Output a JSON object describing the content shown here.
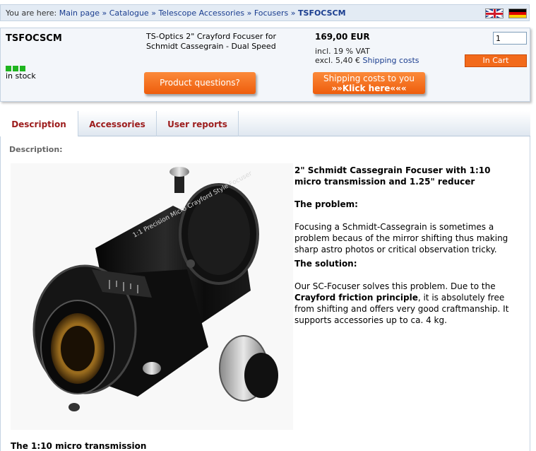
{
  "breadcrumb": {
    "prefix": "You are here:",
    "items": [
      "Main page",
      "Catalogue",
      "Telescope Accessories",
      "Focusers"
    ],
    "separator": "»",
    "current": "TSFOCSCM"
  },
  "languages": [
    "english-flag-icon",
    "german-flag-icon"
  ],
  "product": {
    "sku": "TSFOCSCM",
    "stock_text": "in stock",
    "name": "TS-Optics 2\" Crayford Focuser for Schmidt Cassegrain - Dual Speed",
    "price": "169,00 EUR",
    "vat": "incl. 19 % VAT",
    "excl_prefix": "excl. 5,40 €",
    "shipping_link": "Shipping costs",
    "quantity": "1",
    "cart_label": "In Cart",
    "questions_label": "Product questions?",
    "shipping_btn_line1": "Shipping costs to you",
    "shipping_btn_line2": "»»Klick here«««"
  },
  "tabs": [
    "Description",
    "Accessories",
    "User reports"
  ],
  "description": {
    "label": "Description:",
    "heading": "2\" Schmidt Cassegrain Focuser with 1:10 micro transmission and 1.25\" reducer",
    "problem_title": "The problem:",
    "problem_text": "Focusing a Schmidt-Cassegrain is sometimes a problem becaus of the mirror shifting thus making sharp astro photos or critical observation tricky.",
    "solution_title": "The solution:",
    "solution_text_1": "Our SC-Focuser solves this problem. Due to the",
    "solution_bold": "Crayford friction principle",
    "solution_text_2": ", it is absolutely free from shifting and offers very good craftmanship. It supports accessories up to ca. 4 kg.",
    "next_heading": "The 1:10 micro transmission",
    "photo_label": "1:1 Precision Micro Crayford Style Focuser"
  },
  "colors": {
    "accent_orange": "#f26a1b",
    "link_blue": "#1a3d8f",
    "tab_red": "#9c1c1c",
    "stock_green": "#1fb51f"
  }
}
